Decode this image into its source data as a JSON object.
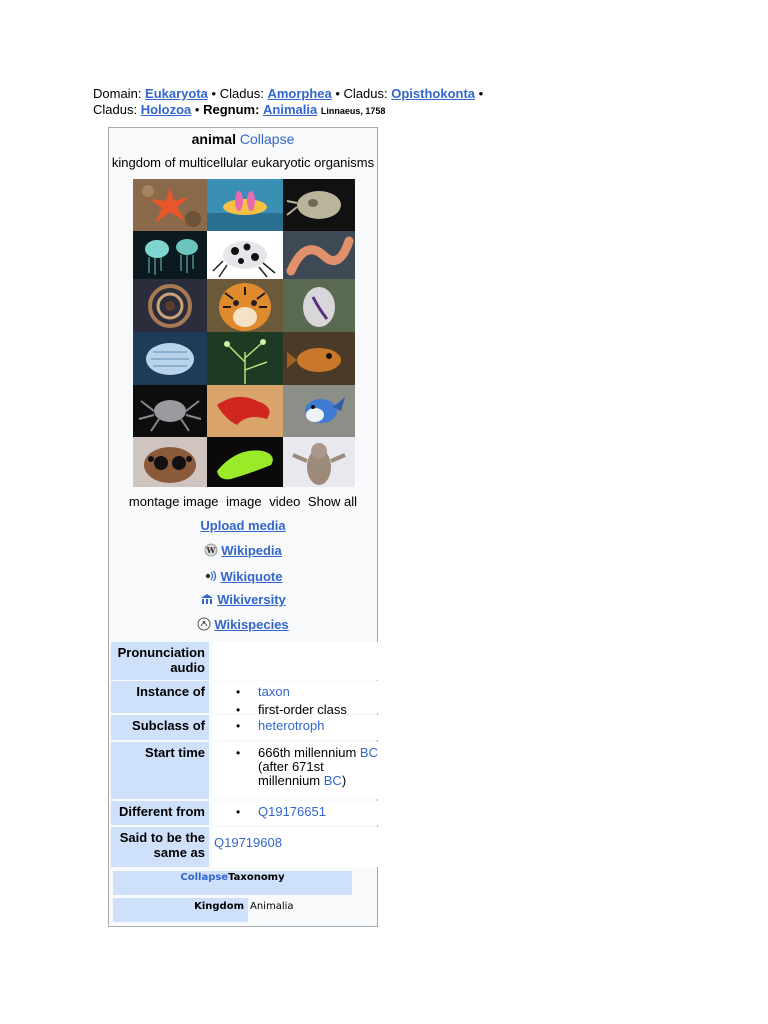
{
  "taxonomy_line": {
    "domain_label": "Domain:",
    "domain_value": "Eukaryota",
    "cladus1_label": "Cladus:",
    "cladus1_value": "Amorphea",
    "cladus2_label": "Cladus:",
    "cladus2_value": "Opisthokonta",
    "cladus3_label": "Cladus:",
    "cladus3_value": "Holozoa",
    "regnum_label": "Regnum:",
    "regnum_value": "Animalia",
    "authority": "Linnaeus, 1758",
    "separator": "•"
  },
  "infobox": {
    "title": "animal",
    "collapse_label": "Collapse",
    "description": "kingdom of multicellular eukaryotic organisms",
    "media_tabs": [
      "montage image",
      "image",
      "video",
      "Show all"
    ],
    "upload_media": "Upload media",
    "sister_projects": [
      {
        "label": "Wikipedia",
        "icon": "wikipedia-icon"
      },
      {
        "label": "Wikiquote",
        "icon": "wikiquote-icon"
      },
      {
        "label": "Wikiversity",
        "icon": "wikiversity-icon"
      },
      {
        "label": "Wikispecies",
        "icon": "wikispecies-icon"
      }
    ],
    "properties": {
      "pronunciation_audio": {
        "label": "Pronunciation audio"
      },
      "instance_of": {
        "label": "Instance of",
        "values": [
          "taxon",
          "first-order class"
        ]
      },
      "subclass_of": {
        "label": "Subclass of",
        "values": [
          "heterotroph"
        ]
      },
      "start_time": {
        "label": "Start time",
        "text_a": "666th millennium",
        "link_a": "BC",
        "text_b": "(after 671st millennium",
        "link_b": "BC",
        "text_c": ")"
      },
      "different_from": {
        "label": "Different from",
        "values": [
          "Q19176651"
        ]
      },
      "said_to_be_same_as": {
        "label": "Said to be the same as",
        "value": "Q19719608"
      }
    },
    "taxonomy_box": {
      "collapse_label": "Collapse",
      "header": "Taxonomy",
      "kingdom_label": "Kingdom",
      "kingdom_value": "Animalia"
    }
  },
  "montage_tiles": [
    "starfish-photo",
    "nudibranch-photo",
    "cuttlefish-photo",
    "jellyfish-photo",
    "ladybird-beetle-photo",
    "bristle-worm-photo",
    "fanworm-photo",
    "tiger-photo",
    "sea-slug-photo",
    "isopod-photo",
    "hydroid-photo",
    "crab-like-fish-photo",
    "crab-photo",
    "red-flatworm-photo",
    "blue-jay-photo",
    "jumping-spider-photo",
    "green-flatworm-photo",
    "owl-photo"
  ]
}
